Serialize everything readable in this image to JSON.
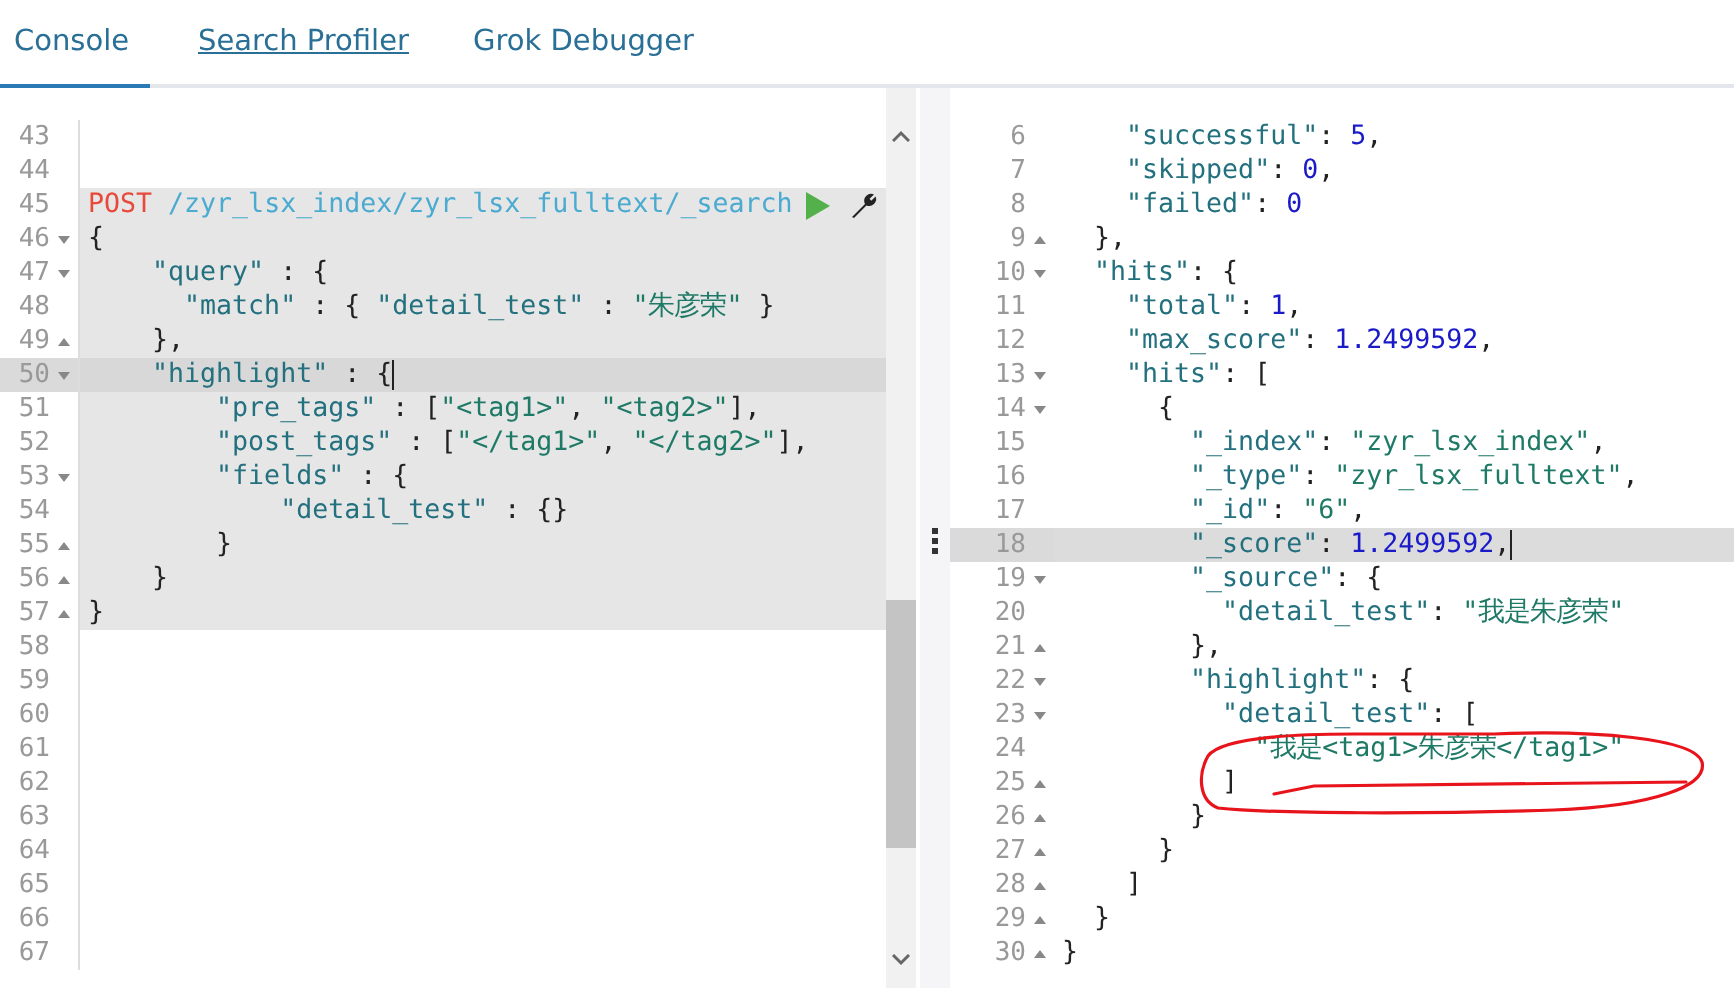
{
  "tabs": [
    {
      "label": "Console",
      "selected": true,
      "hovered": false
    },
    {
      "label": "Search Profiler",
      "selected": false,
      "hovered": true
    },
    {
      "label": "Grok Debugger",
      "selected": false,
      "hovered": false
    }
  ],
  "request_editor": {
    "lines": [
      {
        "number": "43",
        "fold_start": false,
        "fold_end": false,
        "in_request": false,
        "current": false
      },
      {
        "number": "44",
        "fold_start": false,
        "fold_end": false,
        "in_request": false,
        "current": false
      },
      {
        "number": "45",
        "fold_start": false,
        "fold_end": false,
        "in_request": true,
        "current": false,
        "tokens": [
          {
            "kind": "method",
            "text": "POST "
          },
          {
            "kind": "url",
            "text": "/zyr_lsx_index/zyr_lsx_fulltext/_search"
          }
        ]
      },
      {
        "number": "46",
        "fold_start": true,
        "fold_end": false,
        "in_request": true,
        "current": false,
        "tokens": [
          {
            "kind": "punct",
            "text": "{"
          }
        ]
      },
      {
        "number": "47",
        "fold_start": true,
        "fold_end": false,
        "in_request": true,
        "current": false,
        "tokens": [
          {
            "kind": "key",
            "text": "    \"query\""
          },
          {
            "kind": "punct",
            "text": " : {"
          }
        ]
      },
      {
        "number": "48",
        "fold_start": false,
        "fold_end": false,
        "in_request": true,
        "current": false,
        "tokens": [
          {
            "kind": "key",
            "text": "      \"match\""
          },
          {
            "kind": "punct",
            "text": " : { "
          },
          {
            "kind": "key",
            "text": "\"detail_test\""
          },
          {
            "kind": "punct",
            "text": " : "
          },
          {
            "kind": "string",
            "text": "\"朱彦荣\""
          },
          {
            "kind": "punct",
            "text": " }"
          }
        ]
      },
      {
        "number": "49",
        "fold_start": false,
        "fold_end": true,
        "in_request": true,
        "current": false,
        "tokens": [
          {
            "kind": "punct",
            "text": "    },"
          }
        ]
      },
      {
        "number": "50",
        "fold_start": true,
        "fold_end": false,
        "in_request": true,
        "current": true,
        "tokens": [
          {
            "kind": "key",
            "text": "    \"highlight\""
          },
          {
            "kind": "punct",
            "text": " : {"
          }
        ]
      },
      {
        "number": "51",
        "fold_start": false,
        "fold_end": false,
        "in_request": true,
        "current": false,
        "tokens": [
          {
            "kind": "key",
            "text": "        \"pre_tags\""
          },
          {
            "kind": "punct",
            "text": " : ["
          },
          {
            "kind": "string",
            "text": "\"<tag1>\""
          },
          {
            "kind": "punct",
            "text": ", "
          },
          {
            "kind": "string",
            "text": "\"<tag2>\""
          },
          {
            "kind": "punct",
            "text": "],"
          }
        ]
      },
      {
        "number": "52",
        "fold_start": false,
        "fold_end": false,
        "in_request": true,
        "current": false,
        "tokens": [
          {
            "kind": "key",
            "text": "        \"post_tags\""
          },
          {
            "kind": "punct",
            "text": " : ["
          },
          {
            "kind": "string",
            "text": "\"</tag1>\""
          },
          {
            "kind": "punct",
            "text": ", "
          },
          {
            "kind": "string",
            "text": "\"</tag2>\""
          },
          {
            "kind": "punct",
            "text": "],"
          }
        ]
      },
      {
        "number": "53",
        "fold_start": true,
        "fold_end": false,
        "in_request": true,
        "current": false,
        "tokens": [
          {
            "kind": "key",
            "text": "        \"fields\""
          },
          {
            "kind": "punct",
            "text": " : {"
          }
        ]
      },
      {
        "number": "54",
        "fold_start": false,
        "fold_end": false,
        "in_request": true,
        "current": false,
        "tokens": [
          {
            "kind": "key",
            "text": "            \"detail_test\""
          },
          {
            "kind": "punct",
            "text": " : {}"
          }
        ]
      },
      {
        "number": "55",
        "fold_start": false,
        "fold_end": true,
        "in_request": true,
        "current": false,
        "tokens": [
          {
            "kind": "punct",
            "text": "        }"
          }
        ]
      },
      {
        "number": "56",
        "fold_start": false,
        "fold_end": true,
        "in_request": true,
        "current": false,
        "tokens": [
          {
            "kind": "punct",
            "text": "    }"
          }
        ]
      },
      {
        "number": "57",
        "fold_start": false,
        "fold_end": true,
        "in_request": true,
        "current": false,
        "tokens": [
          {
            "kind": "punct",
            "text": "}"
          }
        ]
      },
      {
        "number": "58",
        "fold_start": false,
        "fold_end": false,
        "in_request": false,
        "current": false
      },
      {
        "number": "59",
        "fold_start": false,
        "fold_end": false,
        "in_request": false,
        "current": false
      },
      {
        "number": "60",
        "fold_start": false,
        "fold_end": false,
        "in_request": false,
        "current": false
      },
      {
        "number": "61",
        "fold_start": false,
        "fold_end": false,
        "in_request": false,
        "current": false
      },
      {
        "number": "62",
        "fold_start": false,
        "fold_end": false,
        "in_request": false,
        "current": false
      },
      {
        "number": "63",
        "fold_start": false,
        "fold_end": false,
        "in_request": false,
        "current": false
      },
      {
        "number": "64",
        "fold_start": false,
        "fold_end": false,
        "in_request": false,
        "current": false
      },
      {
        "number": "65",
        "fold_start": false,
        "fold_end": false,
        "in_request": false,
        "current": false
      },
      {
        "number": "66",
        "fold_start": false,
        "fold_end": false,
        "in_request": false,
        "current": false
      },
      {
        "number": "67",
        "fold_start": false,
        "fold_end": false,
        "in_request": false,
        "current": false
      }
    ]
  },
  "response_viewer": {
    "lines": [
      {
        "number": "6",
        "fold_start": false,
        "fold_end": false,
        "current": false,
        "tokens": [
          {
            "kind": "key",
            "text": "    \"successful\""
          },
          {
            "kind": "punct",
            "text": ": "
          },
          {
            "kind": "number",
            "text": "5"
          },
          {
            "kind": "punct",
            "text": ","
          }
        ]
      },
      {
        "number": "7",
        "fold_start": false,
        "fold_end": false,
        "current": false,
        "tokens": [
          {
            "kind": "key",
            "text": "    \"skipped\""
          },
          {
            "kind": "punct",
            "text": ": "
          },
          {
            "kind": "number",
            "text": "0"
          },
          {
            "kind": "punct",
            "text": ","
          }
        ]
      },
      {
        "number": "8",
        "fold_start": false,
        "fold_end": false,
        "current": false,
        "tokens": [
          {
            "kind": "key",
            "text": "    \"failed\""
          },
          {
            "kind": "punct",
            "text": ": "
          },
          {
            "kind": "number",
            "text": "0"
          }
        ]
      },
      {
        "number": "9",
        "fold_start": false,
        "fold_end": true,
        "current": false,
        "tokens": [
          {
            "kind": "punct",
            "text": "  },"
          }
        ]
      },
      {
        "number": "10",
        "fold_start": true,
        "fold_end": false,
        "current": false,
        "tokens": [
          {
            "kind": "key",
            "text": "  \"hits\""
          },
          {
            "kind": "punct",
            "text": ": {"
          }
        ]
      },
      {
        "number": "11",
        "fold_start": false,
        "fold_end": false,
        "current": false,
        "tokens": [
          {
            "kind": "key",
            "text": "    \"total\""
          },
          {
            "kind": "punct",
            "text": ": "
          },
          {
            "kind": "number",
            "text": "1"
          },
          {
            "kind": "punct",
            "text": ","
          }
        ]
      },
      {
        "number": "12",
        "fold_start": false,
        "fold_end": false,
        "current": false,
        "tokens": [
          {
            "kind": "key",
            "text": "    \"max_score\""
          },
          {
            "kind": "punct",
            "text": ": "
          },
          {
            "kind": "number",
            "text": "1.2499592"
          },
          {
            "kind": "punct",
            "text": ","
          }
        ]
      },
      {
        "number": "13",
        "fold_start": true,
        "fold_end": false,
        "current": false,
        "tokens": [
          {
            "kind": "key",
            "text": "    \"hits\""
          },
          {
            "kind": "punct",
            "text": ": ["
          }
        ]
      },
      {
        "number": "14",
        "fold_start": true,
        "fold_end": false,
        "current": false,
        "tokens": [
          {
            "kind": "punct",
            "text": "      {"
          }
        ]
      },
      {
        "number": "15",
        "fold_start": false,
        "fold_end": false,
        "current": false,
        "tokens": [
          {
            "kind": "key",
            "text": "        \"_index\""
          },
          {
            "kind": "punct",
            "text": ": "
          },
          {
            "kind": "string",
            "text": "\"zyr_lsx_index\""
          },
          {
            "kind": "punct",
            "text": ","
          }
        ]
      },
      {
        "number": "16",
        "fold_start": false,
        "fold_end": false,
        "current": false,
        "tokens": [
          {
            "kind": "key",
            "text": "        \"_type\""
          },
          {
            "kind": "punct",
            "text": ": "
          },
          {
            "kind": "string",
            "text": "\"zyr_lsx_fulltext\""
          },
          {
            "kind": "punct",
            "text": ","
          }
        ]
      },
      {
        "number": "17",
        "fold_start": false,
        "fold_end": false,
        "current": false,
        "tokens": [
          {
            "kind": "key",
            "text": "        \"_id\""
          },
          {
            "kind": "punct",
            "text": ": "
          },
          {
            "kind": "string",
            "text": "\"6\""
          },
          {
            "kind": "punct",
            "text": ","
          }
        ]
      },
      {
        "number": "18",
        "fold_start": false,
        "fold_end": false,
        "current": true,
        "tokens": [
          {
            "kind": "key",
            "text": "        \"_score\""
          },
          {
            "kind": "punct",
            "text": ": "
          },
          {
            "kind": "number",
            "text": "1.2499592"
          },
          {
            "kind": "punct",
            "text": ","
          }
        ]
      },
      {
        "number": "19",
        "fold_start": true,
        "fold_end": false,
        "current": false,
        "tokens": [
          {
            "kind": "key",
            "text": "        \"_source\""
          },
          {
            "kind": "punct",
            "text": ": {"
          }
        ]
      },
      {
        "number": "20",
        "fold_start": false,
        "fold_end": false,
        "current": false,
        "tokens": [
          {
            "kind": "key",
            "text": "          \"detail_test\""
          },
          {
            "kind": "punct",
            "text": ": "
          },
          {
            "kind": "string",
            "text": "\"我是朱彦荣\""
          }
        ]
      },
      {
        "number": "21",
        "fold_start": false,
        "fold_end": true,
        "current": false,
        "tokens": [
          {
            "kind": "punct",
            "text": "        },"
          }
        ]
      },
      {
        "number": "22",
        "fold_start": true,
        "fold_end": false,
        "current": false,
        "tokens": [
          {
            "kind": "key",
            "text": "        \"highlight\""
          },
          {
            "kind": "punct",
            "text": ": {"
          }
        ]
      },
      {
        "number": "23",
        "fold_start": true,
        "fold_end": false,
        "current": false,
        "tokens": [
          {
            "kind": "key",
            "text": "          \"detail_test\""
          },
          {
            "kind": "punct",
            "text": ": ["
          }
        ]
      },
      {
        "number": "24",
        "fold_start": false,
        "fold_end": false,
        "current": false,
        "tokens": [
          {
            "kind": "string",
            "text": "            \"我是<tag1>朱彦荣</tag1>\""
          }
        ]
      },
      {
        "number": "25",
        "fold_start": false,
        "fold_end": true,
        "current": false,
        "tokens": [
          {
            "kind": "punct",
            "text": "          ]"
          }
        ]
      },
      {
        "number": "26",
        "fold_start": false,
        "fold_end": true,
        "current": false,
        "tokens": [
          {
            "kind": "punct",
            "text": "        }"
          }
        ]
      },
      {
        "number": "27",
        "fold_start": false,
        "fold_end": true,
        "current": false,
        "tokens": [
          {
            "kind": "punct",
            "text": "      }"
          }
        ]
      },
      {
        "number": "28",
        "fold_start": false,
        "fold_end": true,
        "current": false,
        "tokens": [
          {
            "kind": "punct",
            "text": "    ]"
          }
        ]
      },
      {
        "number": "29",
        "fold_start": false,
        "fold_end": true,
        "current": false,
        "tokens": [
          {
            "kind": "punct",
            "text": "  }"
          }
        ]
      },
      {
        "number": "30",
        "fold_start": false,
        "fold_end": true,
        "current": false,
        "tokens": [
          {
            "kind": "punct",
            "text": "}"
          }
        ]
      }
    ]
  }
}
